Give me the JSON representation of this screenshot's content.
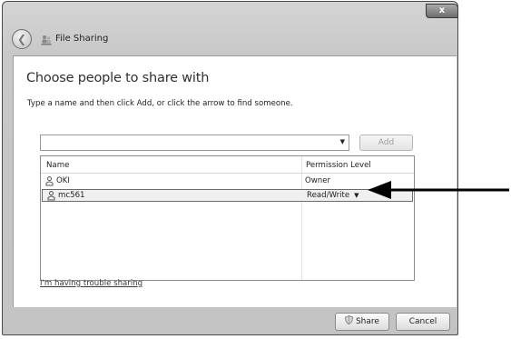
{
  "window": {
    "title": "File Sharing",
    "close_glyph": "x"
  },
  "dialog": {
    "heading": "Choose people to share with",
    "instruction": "Type a name and then click Add, or click the arrow to find someone.",
    "name_input": {
      "value": "",
      "placeholder": ""
    },
    "add_label": "Add",
    "columns": {
      "name": "Name",
      "permission": "Permission Level"
    },
    "users": [
      {
        "name": "OKI",
        "permission": "Owner",
        "icon": "user-icon"
      },
      {
        "name": "mc561",
        "permission": "Read/Write",
        "icon": "user-icon",
        "selected": true
      }
    ],
    "trouble_link": "I'm having trouble sharing",
    "share_label": "Share",
    "cancel_label": "Cancel"
  },
  "colors": {
    "chrome": "#c8c8c8",
    "selected_row": "#f0f0f0",
    "annotation_arrow": "#000000"
  }
}
